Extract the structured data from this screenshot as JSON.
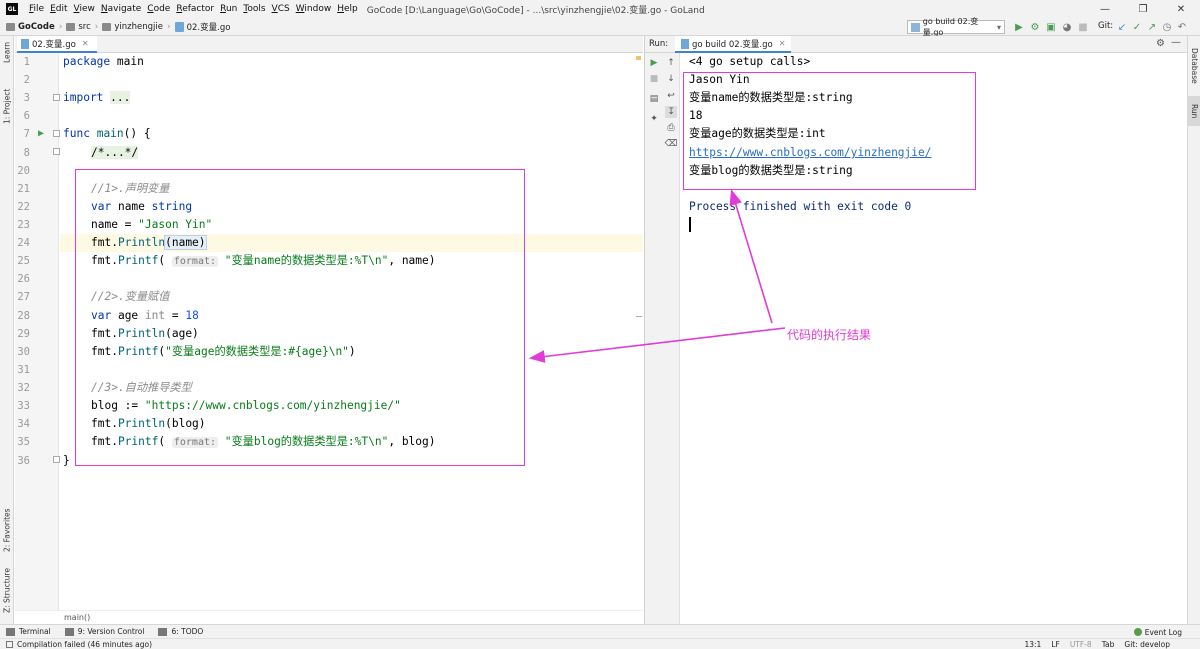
{
  "menubar": {
    "items": [
      {
        "first": "F",
        "rest": "ile"
      },
      {
        "first": "E",
        "rest": "dit"
      },
      {
        "first": "V",
        "rest": "iew"
      },
      {
        "first": "N",
        "rest": "avigate"
      },
      {
        "first": "C",
        "rest": "ode"
      },
      {
        "first": "R",
        "rest": "efactor"
      },
      {
        "first": "R",
        "rest": "un"
      },
      {
        "first": "T",
        "rest": "ools"
      },
      {
        "first": "V",
        "rest": "CS"
      },
      {
        "first": "W",
        "rest": "indow"
      },
      {
        "first": "H",
        "rest": "elp"
      }
    ],
    "window_title": "GoCode [D:\\Language\\Go\\GoCode] - ...\\src\\yinzhengjie\\02.变量.go - GoLand",
    "logo_text": "GL"
  },
  "navbar": {
    "project": "GoCode",
    "crumbs": [
      "src",
      "yinzhengjie",
      "02.变量.go"
    ],
    "run_config": "go build 02.变量.go",
    "git_label": "Git:"
  },
  "left_strip": {
    "learn": "Learn",
    "project": "1: Project",
    "favorites": "2: Favorites",
    "structure": "Z: Structure"
  },
  "right_strip": {
    "database": "Database",
    "run": "Run"
  },
  "editor": {
    "tab_label": "02.变量.go",
    "line_numbers": [
      "1",
      "2",
      "3",
      "6",
      "7",
      "8",
      "20",
      "21",
      "22",
      "23",
      "24",
      "25",
      "26",
      "27",
      "28",
      "29",
      "30",
      "31",
      "32",
      "33",
      "34",
      "35",
      "36"
    ],
    "code": {
      "l1_kw": "package",
      "l1_rest": " main",
      "l3_kw": "import",
      "l3_fold": "...",
      "l7_kw": "func",
      "l7_fn": "main",
      "l7_rest": "() {",
      "l8_fold": "/*...*/",
      "l21": "//1>.声明变量",
      "l22_kw": "var",
      "l22_name": " name ",
      "l22_type": "string",
      "l23_a": "name = ",
      "l23_str": "\"Jason Yin\"",
      "l24_pkg": "fmt.",
      "l24_fn": "Println",
      "l24_arg": "(name)",
      "l25_pkg": "fmt.",
      "l25_fn": "Printf",
      "l25_open": "( ",
      "l25_hint": "format:",
      "l25_str": " \"变量name的数据类型是:%T\\n\"",
      "l25_rest": ", name)",
      "l27": "//2>.变量赋值",
      "l28_kw": "var",
      "l28_name": " age ",
      "l28_type": "int",
      "l28_eq": " = ",
      "l28_num": "18",
      "l29_pkg": "fmt.",
      "l29_fn": "Println",
      "l29_arg": "(age)",
      "l30_pkg": "fmt.",
      "l30_fn": "Printf",
      "l30_open": "(",
      "l30_str": "\"变量age的数据类型是:#{age}\\n\"",
      "l30_rest": ")",
      "l32": "//3>.自动推导类型",
      "l33_a": "blog := ",
      "l33_str": "\"https://www.cnblogs.com/yinzhengjie/\"",
      "l34_pkg": "fmt.",
      "l34_fn": "Println",
      "l34_arg": "(blog)",
      "l35_pkg": "fmt.",
      "l35_fn": "Printf",
      "l35_open": "( ",
      "l35_hint": "format:",
      "l35_str": " \"变量blog的数据类型是:%T\\n\"",
      "l35_rest": ", blog)",
      "l36": "}"
    },
    "breadcrumb": "main()"
  },
  "run_panel": {
    "label": "Run:",
    "tab_label": "go build 02.变量.go",
    "output": [
      "<4 go setup calls>",
      "Jason Yin",
      "变量name的数据类型是:string",
      "18",
      "变量age的数据类型是:int",
      "https://www.cnblogs.com/yinzhengjie/",
      "变量blog的数据类型是:string",
      "",
      "Process finished with exit code 0"
    ]
  },
  "annotation": {
    "label": "代码的执行结果",
    "color": "#e23cd6"
  },
  "bottom_tools": {
    "terminal": "Terminal",
    "vcs": "9: Version Control",
    "todo": "6: TODO",
    "event_log": "Event Log"
  },
  "statusbar": {
    "message": "Compilation failed (46 minutes ago)",
    "position": "13:1",
    "line_sep": "LF",
    "encoding": "UTF-8",
    "indent": "Tab",
    "git": "Git: develop"
  },
  "colors": {
    "keyword": "#0033b3",
    "string": "#067d17",
    "number": "#1750eb",
    "comment": "#8c8c8c",
    "function": "#00627a",
    "link": "#2a6fbf",
    "accent": "#4083c9",
    "run_green": "#499c54"
  },
  "icons": {
    "run": "play-icon",
    "debug": "bug-icon",
    "stop": "stop-icon",
    "settings": "gear-icon",
    "minimize": "minimize-icon"
  }
}
